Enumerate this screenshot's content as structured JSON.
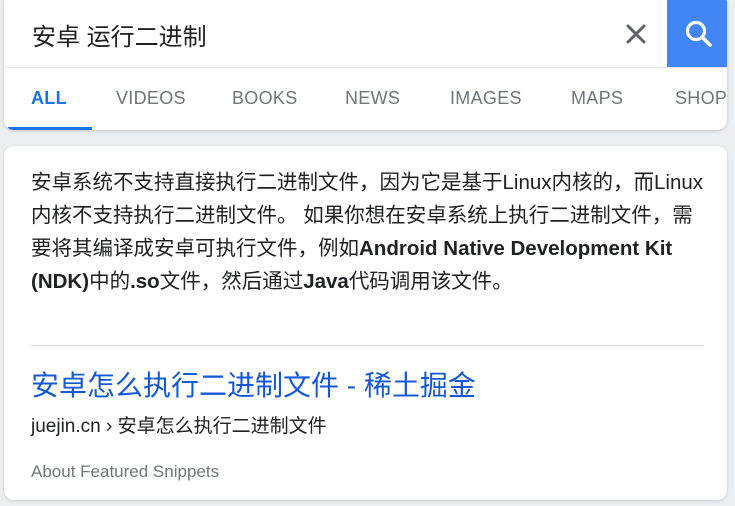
{
  "search": {
    "query": "安卓 运行二进制"
  },
  "tabs": [
    {
      "label": "ALL",
      "active": true
    },
    {
      "label": "VIDEOS",
      "active": false
    },
    {
      "label": "BOOKS",
      "active": false
    },
    {
      "label": "NEWS",
      "active": false
    },
    {
      "label": "IMAGES",
      "active": false
    },
    {
      "label": "MAPS",
      "active": false
    },
    {
      "label": "SHOPI",
      "active": false
    }
  ],
  "featured_snippet": {
    "text_part1": "安卓系统不支持直接执行二进制文件，因为它是基于Linux内核的，而Linux内核不支持执行二进制文件。 如果你想在安卓系统上执行二进制文件，需要将其编译成安卓可执行文件，例如",
    "text_bold1": "Android Native Development Kit (NDK)",
    "text_part2": "中的",
    "text_bold2": ".so",
    "text_part3": "文件，然后通过",
    "text_bold3": "Java",
    "text_part4": "代码调用该文件。",
    "result_title": "安卓怎么执行二进制文件 - 稀土掘金",
    "result_domain": "juejin.cn",
    "result_separator": "›",
    "result_path": "安卓怎么执行二进制文件",
    "about_label": "About Featured Snippets"
  },
  "colors": {
    "accent_blue": "#1a73e8",
    "search_button": "#4285f4",
    "link": "#1558d6",
    "muted": "#70757a"
  }
}
